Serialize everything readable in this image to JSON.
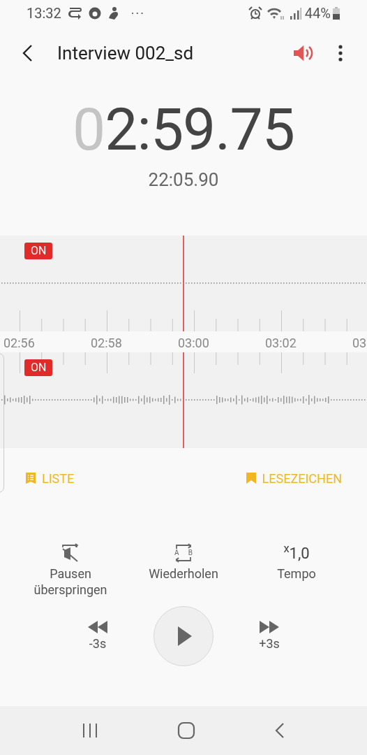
{
  "status_bar": {
    "time": "13:32",
    "more": "···",
    "battery": "44%"
  },
  "header": {
    "title": "Interview 002_sd",
    "speaker_on": true
  },
  "timer": {
    "dim_digit": "0",
    "main": "2:59.75",
    "total": "22:05.90"
  },
  "tracks": [
    {
      "badge": "ON",
      "active": false
    },
    {
      "badge": "ON",
      "active": true
    }
  ],
  "ruler": {
    "labels": [
      "02:56",
      "02:58",
      "03:00",
      "03:02",
      "03"
    ]
  },
  "links": [
    {
      "kind": "list",
      "label": "LISTE"
    },
    {
      "kind": "bookmark",
      "label": "LESEZEICHEN"
    }
  ],
  "options": [
    {
      "kind": "skip",
      "label": "Pausen überspringen"
    },
    {
      "kind": "repeat",
      "label": "Wiederholen",
      "letters": [
        "A",
        "B"
      ]
    },
    {
      "kind": "tempo",
      "value": "$^{x}$1,0",
      "label": "Tempo"
    }
  ],
  "playback": {
    "rewind": "-3s",
    "forward": "+3s"
  }
}
